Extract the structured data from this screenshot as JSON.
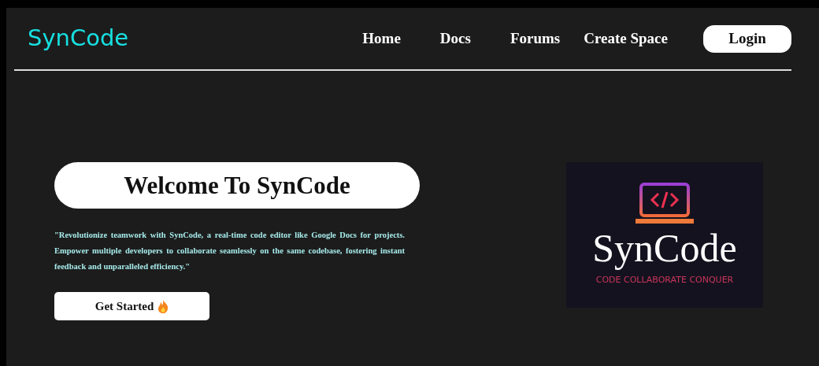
{
  "navbar": {
    "brand": "SynCode",
    "links": [
      {
        "label": "Home"
      },
      {
        "label": "Docs"
      },
      {
        "label": "Forums"
      },
      {
        "label": "Create Space"
      }
    ],
    "login": "Login"
  },
  "hero": {
    "title": "Welcome To SynCode",
    "description": "\"Revolutionize teamwork with SynCode, a real-time code editor like Google Docs for projects. Empower multiple developers to collaborate seamlessly on the same codebase, fostering instant feedback and unparalleled efficiency.\"",
    "button": "Get Started"
  },
  "logo": {
    "name": "SynCode",
    "tagline": "CODE COLLABORATE CONQUER"
  }
}
